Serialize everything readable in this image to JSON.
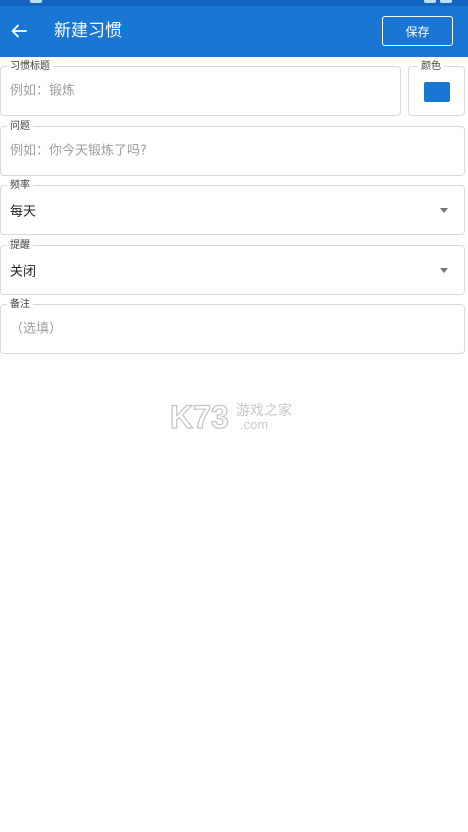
{
  "appbar": {
    "title": "新建习惯",
    "save_label": "保存",
    "background": "#1976d2"
  },
  "form": {
    "title_field": {
      "label": "习惯标题",
      "placeholder": "例如：锻炼",
      "value": ""
    },
    "color_field": {
      "label": "颜色",
      "color": "#1976d2"
    },
    "question_field": {
      "label": "问题",
      "placeholder": "例如：你今天锻炼了吗?",
      "value": ""
    },
    "frequency_field": {
      "label": "频率",
      "value": "每天"
    },
    "reminder_field": {
      "label": "提醒",
      "value": "关闭"
    },
    "notes_field": {
      "label": "备注",
      "placeholder": "（选填）",
      "value": ""
    }
  },
  "watermark": {
    "main": "K73",
    "cn": "游戏之家",
    "sub": ".com"
  }
}
